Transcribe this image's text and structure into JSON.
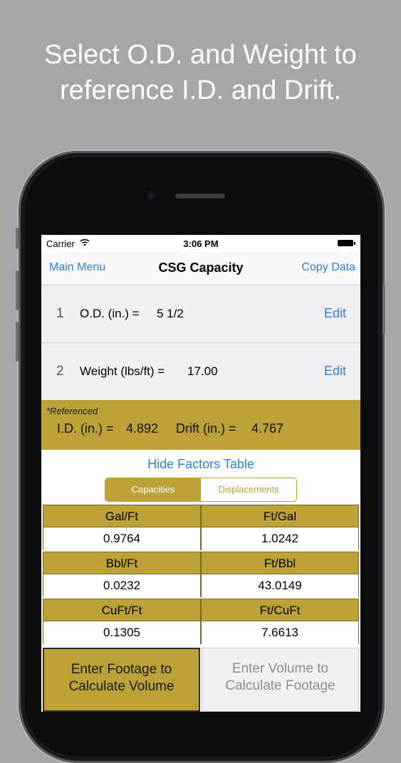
{
  "headline": {
    "line1": "Select O.D. and Weight to",
    "line2": "reference I.D. and Drift."
  },
  "status": {
    "carrier": "Carrier",
    "time": "3:06 PM"
  },
  "nav": {
    "back": "Main Menu",
    "title": "CSG Capacity",
    "action": "Copy Data"
  },
  "rows": [
    {
      "num": "1",
      "label": "O.D. (in.) =",
      "value": "5 1/2",
      "edit": "Edit"
    },
    {
      "num": "2",
      "label": "Weight (lbs/ft) =",
      "value": "17.00",
      "edit": "Edit"
    }
  ],
  "referenced": {
    "note": "*Referenced",
    "id_label": "I.D. (in.) =",
    "id_value": "4.892",
    "drift_label": "Drift (in.) =",
    "drift_value": "4.767"
  },
  "factors_link": "Hide Factors Table",
  "segmented": {
    "options": [
      "Capacities",
      "Displacements"
    ],
    "selected": "Capacities"
  },
  "factors": [
    {
      "left_head": "Gal/Ft",
      "left_val": "0.9764",
      "right_head": "Ft/Gal",
      "right_val": "1.0242"
    },
    {
      "left_head": "Bbl/Ft",
      "left_val": "0.0232",
      "right_head": "Ft/Bbl",
      "right_val": "43.0149"
    },
    {
      "left_head": "CuFt/Ft",
      "left_val": "0.1305",
      "right_head": "Ft/CuFt",
      "right_val": "7.6613"
    }
  ],
  "calc_buttons": {
    "footage_line1": "Enter Footage to",
    "footage_line2": "Calculate Volume",
    "volume_line1": "Enter Volume to",
    "volume_line2": "Calculate Footage"
  },
  "colors": {
    "accent_gold": "#bca236",
    "link_blue": "#2f7fd3",
    "background_gray": "#a6a6a6"
  }
}
